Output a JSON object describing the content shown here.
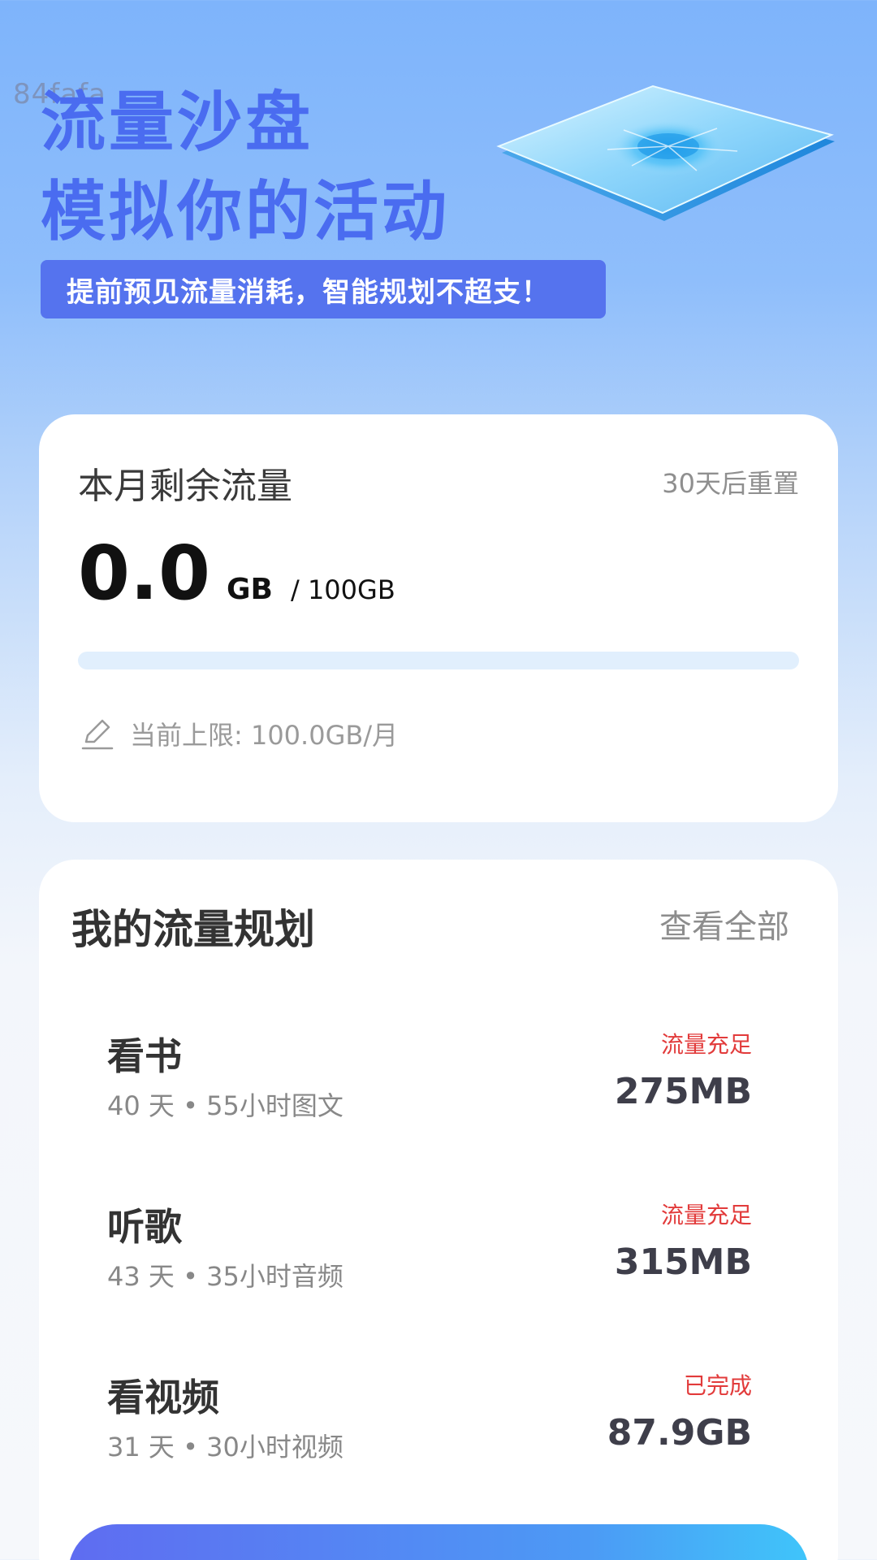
{
  "watermark": "84fafa",
  "hero": {
    "title_line1": "流量沙盘",
    "title_line2": "模拟你的活动",
    "badge": "提前预见流量消耗，智能规划不超支！"
  },
  "usage": {
    "title": "本月剩余流量",
    "reset": "30天后重置",
    "remaining_value": "0.0",
    "unit": "GB",
    "total": "/ 100GB",
    "progress_fraction": 0.0,
    "limit_text": "当前上限: 100.0GB/月"
  },
  "plan": {
    "title": "我的流量规划",
    "view_all": "查看全部",
    "items": [
      {
        "name": "看书",
        "meta": "40 天 • 55小时图文",
        "status": "流量充足",
        "size": "275MB"
      },
      {
        "name": "听歌",
        "meta": "43 天 • 35小时音频",
        "status": "流量充足",
        "size": "315MB"
      },
      {
        "name": "看视频",
        "meta": "31 天 • 30小时视频",
        "status": "已完成",
        "size": "87.9GB"
      }
    ]
  },
  "colors": {
    "accent": "#4a6cf0",
    "badge_bg": "#5573ee",
    "status_red": "#e23b3b",
    "progress_track": "#e1effd"
  },
  "icons": {
    "edit": "pencil-edit-icon",
    "illustration": "glass-plate-illustration"
  }
}
